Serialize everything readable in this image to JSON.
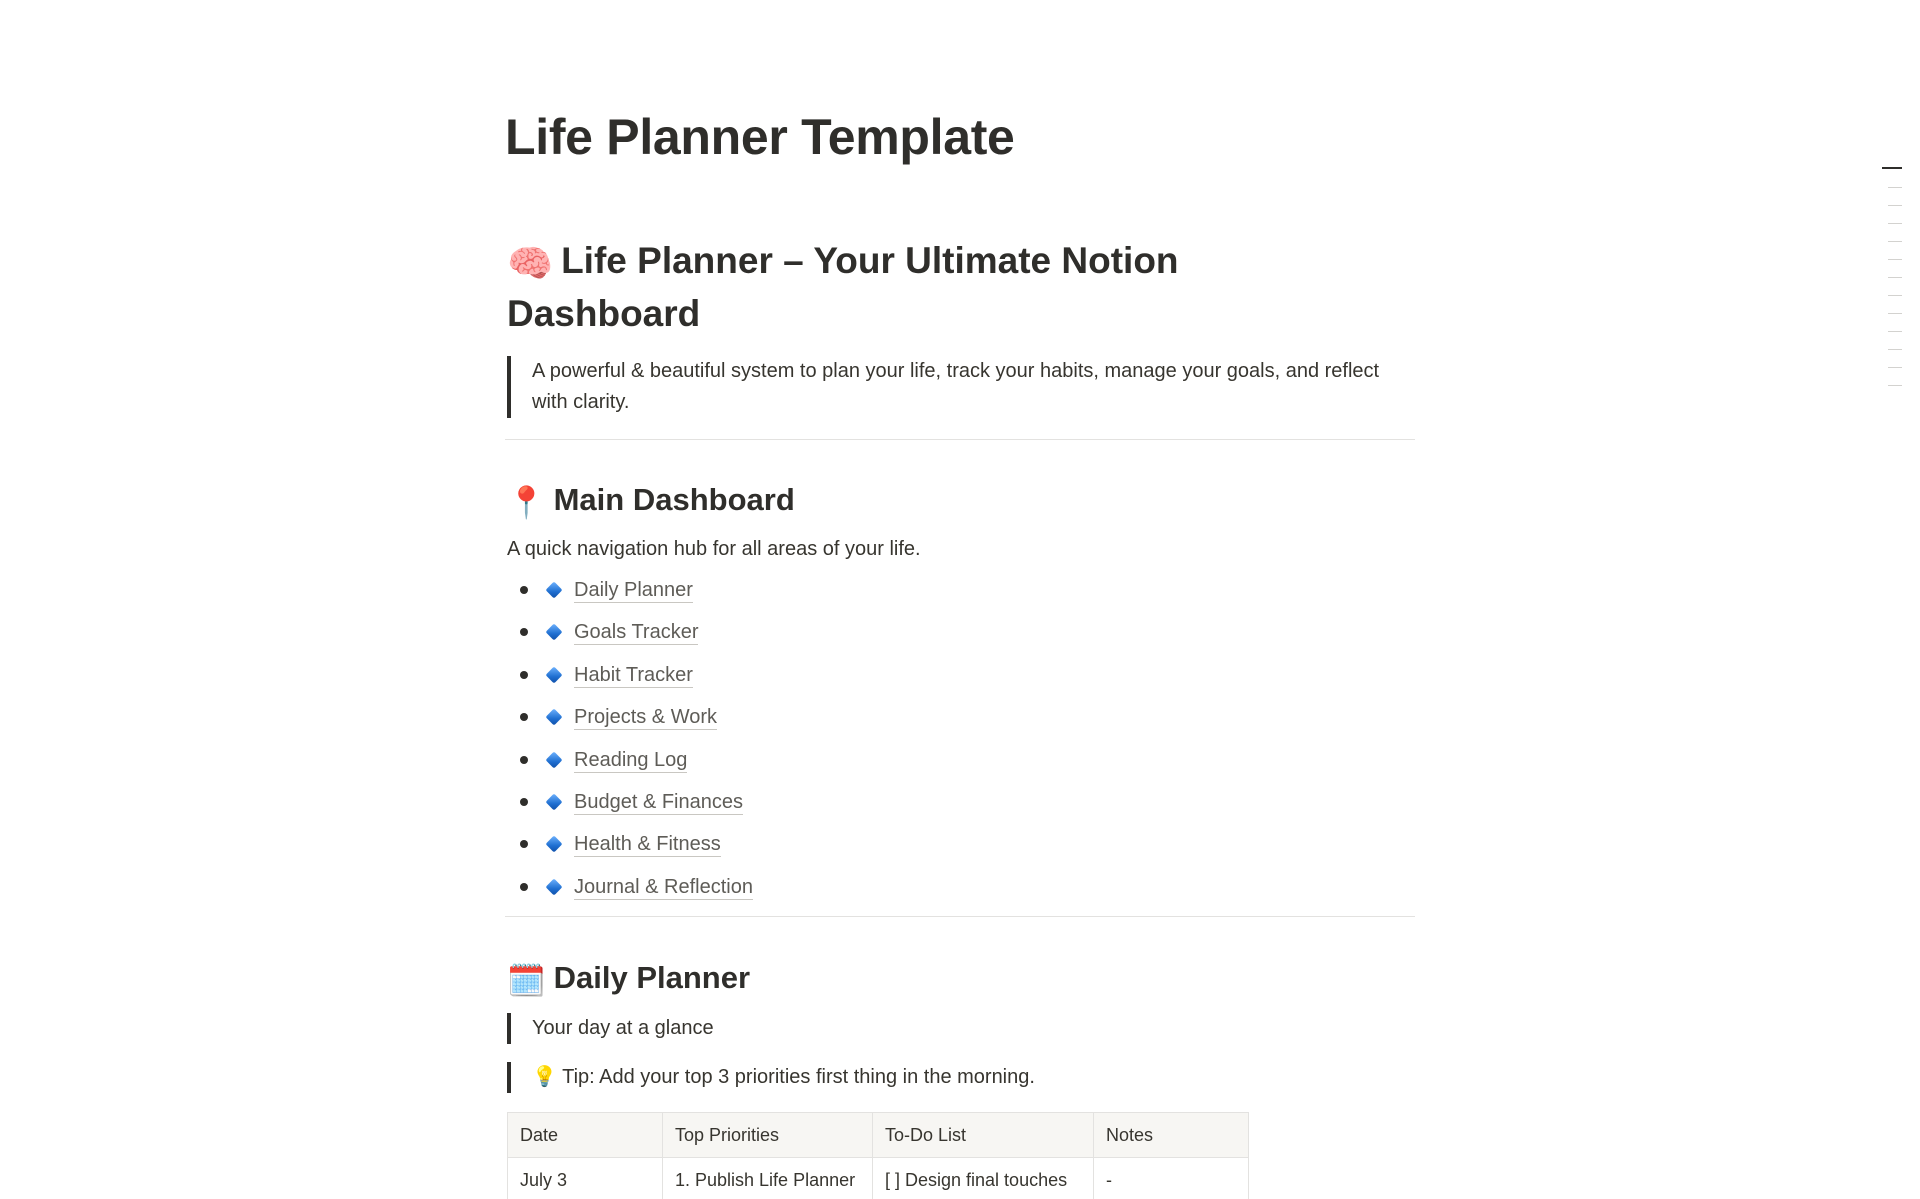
{
  "page": {
    "title": "Life Planner Template"
  },
  "hero": {
    "icon": "brain-icon",
    "emoji": "🧠",
    "heading": "Life Planner – Your Ultimate Notion Dashboard",
    "quote": "A powerful & beautiful system to plan your life, track your habits, manage your goals, and reflect with clarity."
  },
  "main_dashboard": {
    "icon": "pushpin-icon",
    "emoji": "📍",
    "heading": "Main Dashboard",
    "description": "A quick navigation hub for all areas of your life.",
    "links": [
      {
        "label": "Daily Planner",
        "icon": "blue-diamond-icon"
      },
      {
        "label": "Goals Tracker",
        "icon": "blue-diamond-icon"
      },
      {
        "label": "Habit Tracker",
        "icon": "blue-diamond-icon"
      },
      {
        "label": "Projects & Work",
        "icon": "blue-diamond-icon"
      },
      {
        "label": "Reading Log",
        "icon": "blue-diamond-icon"
      },
      {
        "label": "Budget & Finances",
        "icon": "blue-diamond-icon"
      },
      {
        "label": "Health & Fitness",
        "icon": "blue-diamond-icon"
      },
      {
        "label": "Journal & Reflection",
        "icon": "blue-diamond-icon"
      }
    ]
  },
  "daily_planner": {
    "icon": "spiral-calendar-icon",
    "emoji": "🗓️",
    "heading": "Daily Planner",
    "quote_1": "Your day at a glance",
    "tip_icon": "lightbulb-icon",
    "tip_emoji": "💡",
    "tip": "Tip: Add your top 3 priorities first thing in the morning.",
    "table": {
      "headers": [
        "Date",
        "Top Priorities",
        "To-Do List",
        "Notes"
      ],
      "rows": [
        [
          "July 3",
          "1. Publish Life Planner",
          "[ ] Design final touches",
          "-"
        ]
      ]
    }
  },
  "colors": {
    "text": "#37352f",
    "heading": "#2f2e2b",
    "link": "#5e5c57",
    "divider": "#e3e2e0",
    "table_header_bg": "#f7f6f3"
  }
}
